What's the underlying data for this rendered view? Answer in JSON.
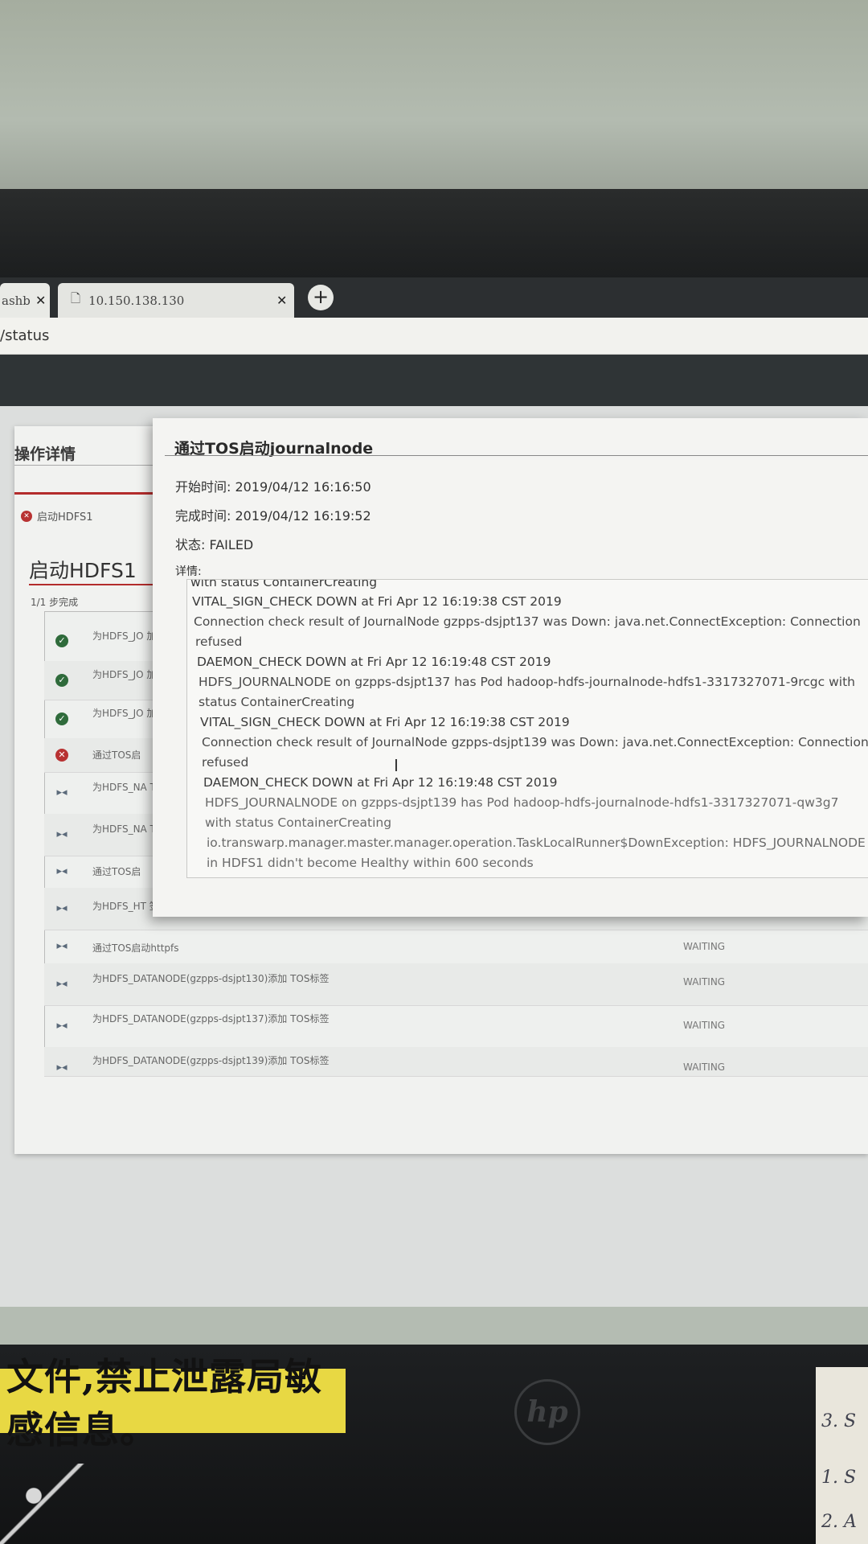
{
  "browser": {
    "tabs": [
      {
        "label": "ashb",
        "active": true
      },
      {
        "label": "10.150.138.130",
        "active": false
      }
    ],
    "new_tab_label": "+",
    "url": "/status"
  },
  "page": {
    "panel_title": "操作详情",
    "crumb": "启动HDFS1",
    "task_title": "启动HDFS1",
    "progress": "1/1 步完成",
    "steps": [
      {
        "name": "为HDFS_JO 加TOS标签",
        "state": "ok",
        "status": ""
      },
      {
        "name": "为HDFS_JO 加TOS标签",
        "state": "ok",
        "status": ""
      },
      {
        "name": "为HDFS_JO 加TOS标签",
        "state": "ok",
        "status": ""
      },
      {
        "name": "通过TOS启",
        "state": "fail",
        "status": ""
      },
      {
        "name": "为HDFS_NA TOS标签",
        "state": "wait",
        "status": ""
      },
      {
        "name": "为HDFS_NA TOS标签",
        "state": "wait",
        "status": ""
      },
      {
        "name": "通过TOS启",
        "state": "wait",
        "status": ""
      },
      {
        "name": "为HDFS_HT 签",
        "state": "wait",
        "status": ""
      },
      {
        "name": "通过TOS启动httpfs",
        "state": "wait",
        "status": "WAITING"
      },
      {
        "name": "为HDFS_DATANODE(gzpps-dsjpt130)添加 TOS标签",
        "state": "wait",
        "status": "WAITING"
      },
      {
        "name": "为HDFS_DATANODE(gzpps-dsjpt137)添加 TOS标签",
        "state": "wait",
        "status": "WAITING"
      },
      {
        "name": "为HDFS_DATANODE(gzpps-dsjpt139)添加 TOS标签",
        "state": "wait",
        "status": "WAITING"
      }
    ]
  },
  "modal": {
    "title": "通过TOS启动journalnode",
    "start_label": "开始时间:",
    "start_value": "2019/04/12 16:16:50",
    "end_label": "完成时间:",
    "end_value": "2019/04/12 16:19:52",
    "state_label": "状态:",
    "state_value": "FAILED",
    "detail_label": "详情:",
    "log": [
      "with status ContainerCreating",
      "VITAL_SIGN_CHECK DOWN at Fri Apr 12 16:19:38 CST 2019",
      "  Connection check result of JournalNode gzpps-dsjpt137 was Down: java.net.ConnectException: Connection",
      "refused",
      "DAEMON_CHECK DOWN at Fri Apr 12 16:19:48 CST 2019",
      "  HDFS_JOURNALNODE on gzpps-dsjpt137 has Pod hadoop-hdfs-journalnode-hdfs1-3317327071-9rcgc with",
      "status ContainerCreating",
      "VITAL_SIGN_CHECK DOWN at Fri Apr 12 16:19:38 CST 2019",
      "  Connection check result of JournalNode gzpps-dsjpt139 was Down: java.net.ConnectException: Connection",
      "refused",
      "DAEMON_CHECK DOWN at Fri Apr 12 16:19:48 CST 2019",
      "  HDFS_JOURNALNODE on gzpps-dsjpt139 has Pod hadoop-hdfs-journalnode-hdfs1-3317327071-qw3g7",
      "with status ContainerCreating",
      "io.transwarp.manager.master.manager.operation.TaskLocalRunner$DownException: HDFS_JOURNALNODE",
      "in HDFS1 didn't become Healthy within 600 seconds"
    ]
  },
  "surroundings": {
    "sticker_text": "文件,禁止泄露局敏感信息。",
    "monitor_brand": "hp",
    "note_lines": [
      "3. S",
      "1. S",
      "2. A"
    ]
  },
  "colors": {
    "fail": "#b83232",
    "ok": "#2f6b3b",
    "header_dark": "#2f3436",
    "sticker_yellow": "#e8d843"
  }
}
